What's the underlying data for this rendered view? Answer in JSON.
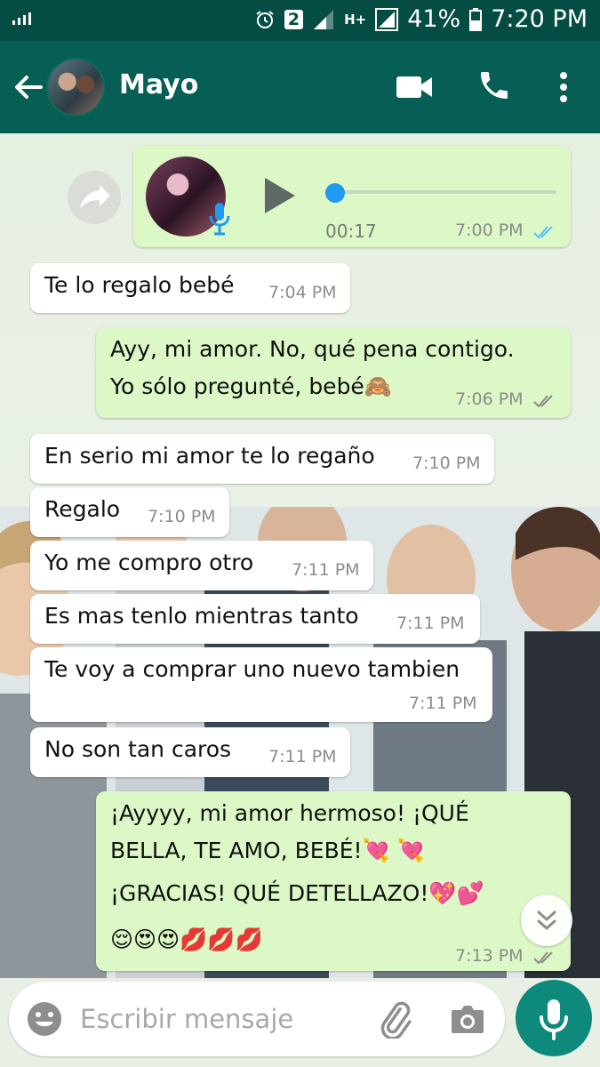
{
  "status_bar": {
    "sim_badge": "2",
    "network": "H+",
    "battery": "41%",
    "time": "7:20 PM"
  },
  "header": {
    "contact_name": "Mayo"
  },
  "voice_note": {
    "duration": "00:17",
    "time": "7:00 PM",
    "progress": 0
  },
  "messages": [
    {
      "dir": "in",
      "lines": [
        "Te lo regalo bebé"
      ],
      "time": "7:04 PM"
    },
    {
      "dir": "out",
      "lines": [
        "Ayy, mi amor. No, qué pena contigo.",
        "Yo sólo pregunté, bebé🙈"
      ],
      "time": "7:06 PM"
    },
    {
      "dir": "in",
      "lines": [
        "En serio mi amor te lo regaño"
      ],
      "time": "7:10 PM"
    },
    {
      "dir": "in",
      "lines": [
        "Regalo"
      ],
      "time": "7:10 PM"
    },
    {
      "dir": "in",
      "lines": [
        "Yo me compro otro"
      ],
      "time": "7:11 PM"
    },
    {
      "dir": "in",
      "lines": [
        "Es mas tenlo mientras tanto"
      ],
      "time": "7:11 PM"
    },
    {
      "dir": "in",
      "lines": [
        "Te voy a comprar uno nuevo tambien"
      ],
      "time": "7:11 PM"
    },
    {
      "dir": "in",
      "lines": [
        "No son tan caros"
      ],
      "time": "7:11 PM"
    },
    {
      "dir": "out",
      "lines": [
        "¡Ayyyy, mi amor hermoso! ¡QUÉ",
        "BELLA, TE AMO, BEBÉ!💘 💘",
        "¡GRACIAS! QUÉ DETELLAZO!💖💕",
        "😌😍😍💋💋💋"
      ],
      "time": "7:13 PM"
    }
  ],
  "composer": {
    "placeholder": "Escribir mensaje"
  },
  "colors": {
    "header": "#075e54",
    "status_bar": "#054d44",
    "outgoing_bubble": "#dcf8c6",
    "incoming_bubble": "#ffffff",
    "read_ticks": "#4fc3f7",
    "mic_button": "#0e8a7d"
  },
  "icons": [
    "signal-icon",
    "alarm-icon",
    "back-arrow-icon",
    "video-call-icon",
    "phone-icon",
    "more-vert-icon",
    "forward-icon",
    "play-icon",
    "microphone-icon",
    "double-check-icon",
    "chevron-down-icon",
    "emoji-icon",
    "paperclip-icon",
    "camera-icon"
  ]
}
